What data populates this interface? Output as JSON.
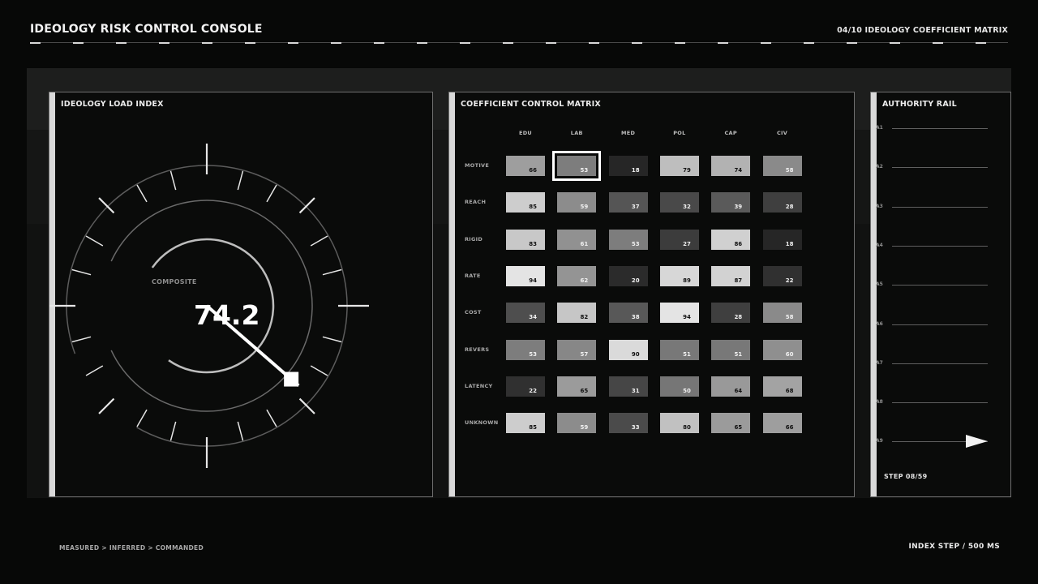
{
  "header": {
    "title": "IDEOLOGY RISK CONTROL CONSOLE",
    "section_indicator": "04/10",
    "section_title": "IDEOLOGY COEFFICIENT MATRIX"
  },
  "gauge": {
    "title": "IDEOLOGY LOAD INDEX",
    "composite_label": "COMPOSITE",
    "composite_value": "74.2"
  },
  "matrix": {
    "title": "COEFFICIENT CONTROL MATRIX",
    "columns": [
      "EDU",
      "LAB",
      "MED",
      "POL",
      "CAP",
      "CIV"
    ],
    "rows": [
      {
        "label": "MOTIVE",
        "values": [
          66,
          53,
          18,
          79,
          74,
          58
        ]
      },
      {
        "label": "REACH",
        "values": [
          85,
          59,
          37,
          32,
          39,
          28
        ]
      },
      {
        "label": "RIGID",
        "values": [
          83,
          61,
          53,
          27,
          86,
          18
        ]
      },
      {
        "label": "RATE",
        "values": [
          94,
          62,
          20,
          89,
          87,
          22
        ]
      },
      {
        "label": "COST",
        "values": [
          34,
          82,
          38,
          94,
          28,
          58
        ]
      },
      {
        "label": "REVERS",
        "values": [
          53,
          57,
          90,
          51,
          51,
          60
        ]
      },
      {
        "label": "LATENCY",
        "values": [
          22,
          65,
          31,
          50,
          64,
          68
        ]
      },
      {
        "label": "UNKNOWN",
        "values": [
          85,
          59,
          33,
          80,
          65,
          66
        ]
      }
    ],
    "selected": {
      "row": 0,
      "col": 1
    }
  },
  "rail": {
    "title": "AUTHORITY RAIL",
    "labels": [
      "A1",
      "A2",
      "A3",
      "A4",
      "A5",
      "A6",
      "A7",
      "A8",
      "A9"
    ],
    "step": "STEP 08/59",
    "active_index": 8
  },
  "footer": {
    "pipeline": "MEASURED > INFERRED > COMMANDED",
    "index_step": "INDEX STEP / 500 MS"
  }
}
